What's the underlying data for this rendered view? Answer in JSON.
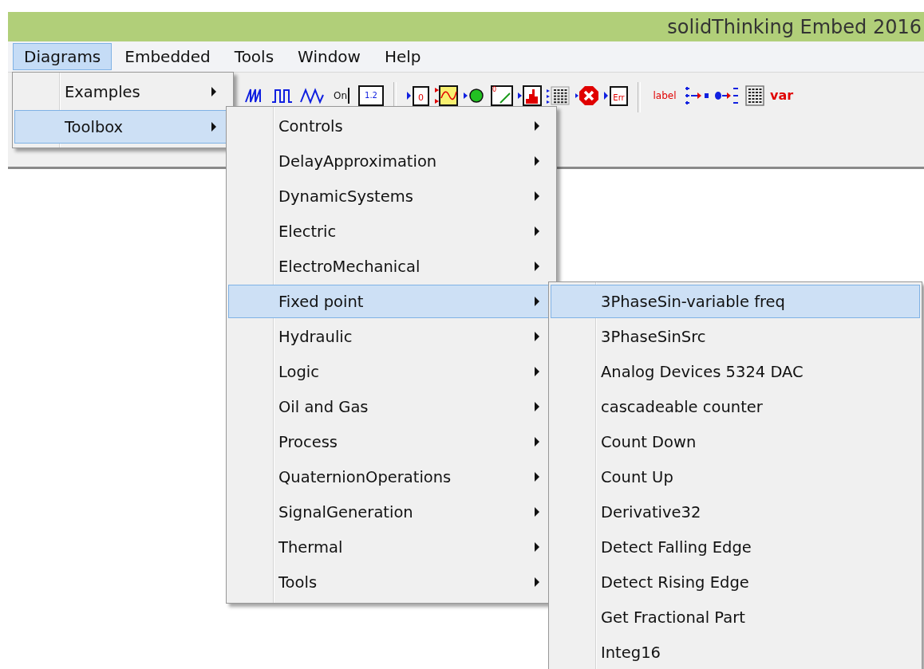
{
  "window": {
    "title": "solidThinking Embed 2016"
  },
  "menu_bar": [
    {
      "label": "Diagrams",
      "selected": true
    },
    {
      "label": "Embedded",
      "selected": false
    },
    {
      "label": "Tools",
      "selected": false
    },
    {
      "label": "Window",
      "selected": false
    },
    {
      "label": "Help",
      "selected": false
    }
  ],
  "toolbar": {
    "groups": [
      [
        {
          "kind": "sawtooth"
        },
        {
          "kind": "square-wave"
        },
        {
          "kind": "triangle-wave"
        },
        {
          "kind": "toggle",
          "text": "On"
        },
        {
          "kind": "display",
          "text": "1.2"
        }
      ],
      [
        {
          "kind": "constant",
          "text": "0"
        },
        {
          "kind": "plot"
        },
        {
          "kind": "led"
        },
        {
          "kind": "slider",
          "text": "0"
        },
        {
          "kind": "histogram"
        },
        {
          "kind": "matrix"
        },
        {
          "kind": "error-stop"
        },
        {
          "kind": "error-code",
          "text": "Err"
        }
      ],
      [
        {
          "kind": "label",
          "text": "label"
        },
        {
          "kind": "bus-split"
        },
        {
          "kind": "bus-merge"
        },
        {
          "kind": "grid"
        },
        {
          "kind": "variable",
          "text": "var"
        }
      ]
    ]
  },
  "diagrams_menu": [
    {
      "label": "Examples",
      "selected": false,
      "submenu": true
    },
    {
      "label": "Toolbox",
      "selected": true,
      "submenu": true
    }
  ],
  "toolbox_menu": [
    {
      "label": "Controls",
      "selected": false,
      "submenu": true
    },
    {
      "label": "DelayApproximation",
      "selected": false,
      "submenu": true
    },
    {
      "label": "DynamicSystems",
      "selected": false,
      "submenu": true
    },
    {
      "label": "Electric",
      "selected": false,
      "submenu": true
    },
    {
      "label": "ElectroMechanical",
      "selected": false,
      "submenu": true
    },
    {
      "label": "Fixed point",
      "selected": true,
      "submenu": true
    },
    {
      "label": "Hydraulic",
      "selected": false,
      "submenu": true
    },
    {
      "label": "Logic",
      "selected": false,
      "submenu": true
    },
    {
      "label": "Oil and Gas",
      "selected": false,
      "submenu": true
    },
    {
      "label": "Process",
      "selected": false,
      "submenu": true
    },
    {
      "label": "QuaternionOperations",
      "selected": false,
      "submenu": true
    },
    {
      "label": "SignalGeneration",
      "selected": false,
      "submenu": true
    },
    {
      "label": "Thermal",
      "selected": false,
      "submenu": true
    },
    {
      "label": "Tools",
      "selected": false,
      "submenu": true
    }
  ],
  "fixed_point_menu": [
    {
      "label": "3PhaseSin-variable freq",
      "selected": true,
      "submenu": false
    },
    {
      "label": "3PhaseSinSrc",
      "selected": false,
      "submenu": false
    },
    {
      "label": "Analog Devices 5324 DAC",
      "selected": false,
      "submenu": false
    },
    {
      "label": "cascadeable counter",
      "selected": false,
      "submenu": false
    },
    {
      "label": "Count Down",
      "selected": false,
      "submenu": false
    },
    {
      "label": "Count Up",
      "selected": false,
      "submenu": false
    },
    {
      "label": "Derivative32",
      "selected": false,
      "submenu": false
    },
    {
      "label": "Detect Falling Edge",
      "selected": false,
      "submenu": false
    },
    {
      "label": "Detect Rising Edge",
      "selected": false,
      "submenu": false
    },
    {
      "label": "Get Fractional Part",
      "selected": false,
      "submenu": false
    },
    {
      "label": "Integ16",
      "selected": false,
      "submenu": false
    }
  ]
}
